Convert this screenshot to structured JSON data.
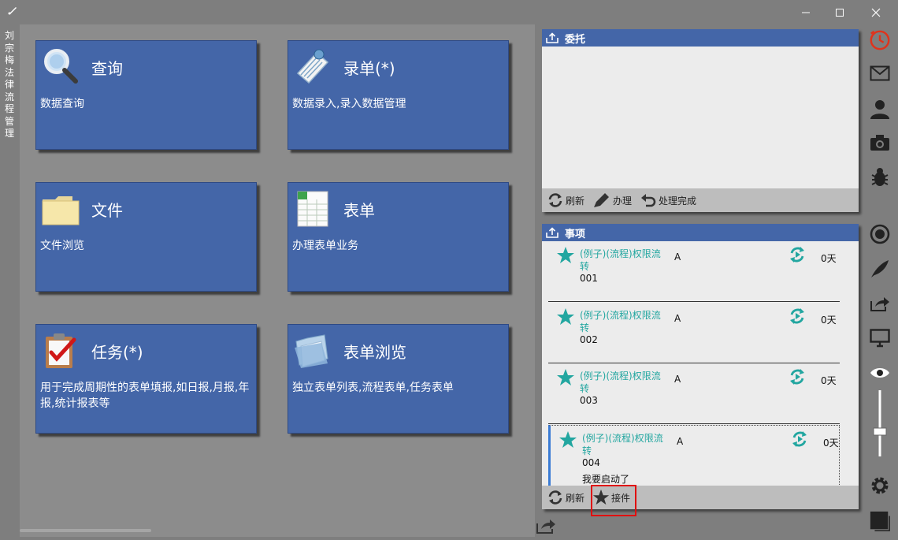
{
  "window": {
    "title_vertical": "刘宗梅法律流程管理",
    "controls": [
      "minimize",
      "maximize",
      "close"
    ]
  },
  "tiles": [
    {
      "title": "查询",
      "desc": "数据查询",
      "icon": "magnifier-icon"
    },
    {
      "title": "录单(*)",
      "desc": "数据录入,录入数据管理",
      "icon": "document-entry-icon"
    },
    {
      "title": "文件",
      "desc": "文件浏览",
      "icon": "folder-icon"
    },
    {
      "title": "表单",
      "desc": "办理表单业务",
      "icon": "spreadsheet-icon"
    },
    {
      "title": "任务(*)",
      "desc": "用于完成周期性的表单填报,如日报,月报,年报,统计报表等",
      "icon": "clipboard-check-icon"
    },
    {
      "title": "表单浏览",
      "desc": "独立表单列表,流程表单,任务表单",
      "icon": "folder-open-icon"
    }
  ],
  "entrust_panel": {
    "title": "委托",
    "footer": {
      "refresh": "刷新",
      "handle": "办理",
      "done": "处理完成"
    }
  },
  "items_panel": {
    "title": "事项",
    "items": [
      {
        "title": "(例子)(流程)权限流转",
        "code": "001",
        "user": "A",
        "days": "0天",
        "note": ""
      },
      {
        "title": "(例子)(流程)权限流转",
        "code": "002",
        "user": "A",
        "days": "0天",
        "note": ""
      },
      {
        "title": "(例子)(流程)权限流转",
        "code": "003",
        "user": "A",
        "days": "0天",
        "note": ""
      },
      {
        "title": "(例子)(流程)权限流转",
        "code": "004",
        "user": "A",
        "days": "0天",
        "note": "我要启动了"
      }
    ],
    "footer": {
      "refresh": "刷新",
      "take": "接件"
    }
  },
  "sidebar": {
    "icons": [
      "clock-icon",
      "mail-icon",
      "user-icon",
      "camera-icon",
      "bug-icon",
      "record-icon",
      "feather-icon",
      "share-icon",
      "monitor-icon",
      "eye-icon",
      "slider-icon",
      "gear-icon",
      "square-icon"
    ],
    "accent": "#e0331c"
  },
  "colors": {
    "tile": "#4466a8",
    "teal": "#22a6a0",
    "background": "#8c8c8c"
  }
}
